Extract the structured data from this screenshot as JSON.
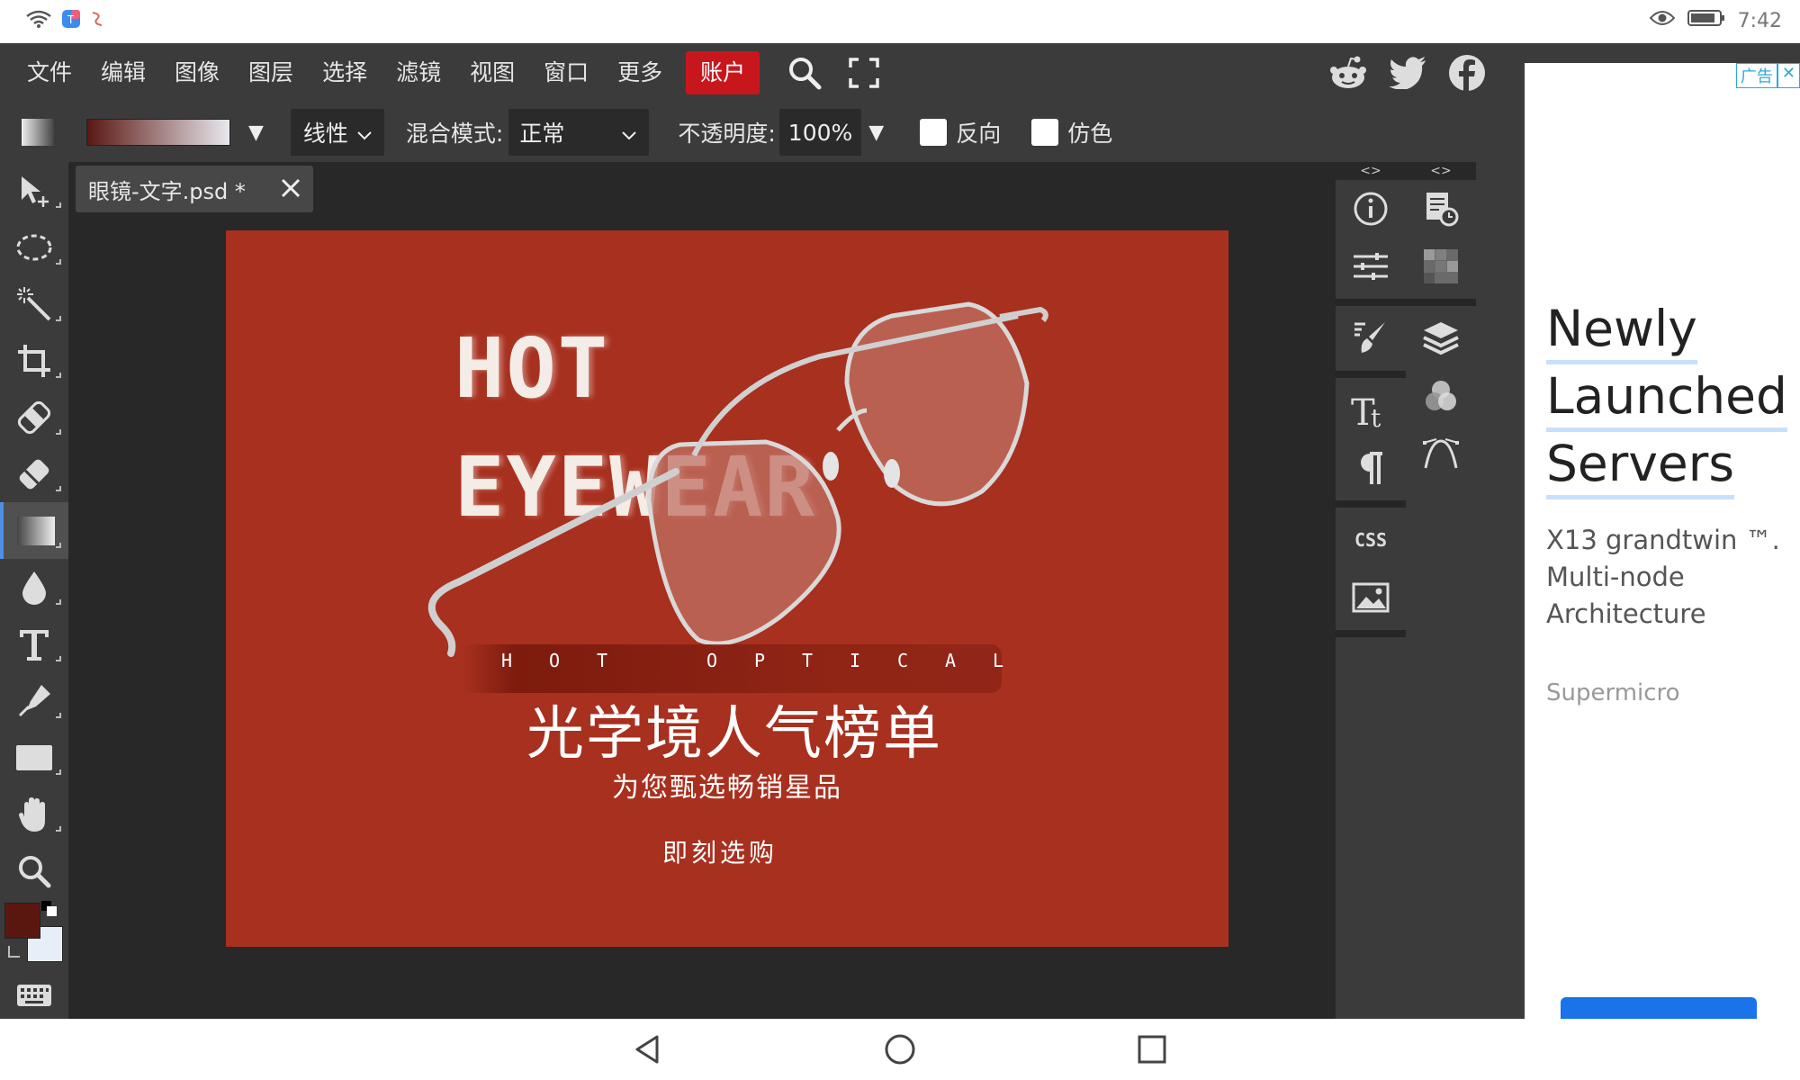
{
  "status_bar": {
    "time": "7:42"
  },
  "menu": {
    "items": [
      "文件",
      "编辑",
      "图像",
      "图层",
      "选择",
      "滤镜",
      "视图",
      "窗口",
      "更多"
    ],
    "account": "账户"
  },
  "options": {
    "gradient_type": "线性",
    "blend_label": "混合模式:",
    "blend_value": "正常",
    "opacity_label": "不透明度:",
    "opacity_value": "100%",
    "reverse_label": "反向",
    "dither_label": "仿色"
  },
  "document": {
    "tab_title": "眼镜-文字.psd *"
  },
  "artwork": {
    "line1": "HOT",
    "line2": "EYEWEAR",
    "tagline_letters": [
      "H",
      "O",
      "T",
      "",
      "O",
      "P",
      "T",
      "I",
      "C",
      "A",
      "L"
    ],
    "headline": "光学境人气榜单",
    "subline": "为您甄选畅销星品",
    "cta": "即刻选购"
  },
  "panels": {
    "collapse_label": "<>",
    "css_label": "CSS"
  },
  "ad": {
    "badge": "广告",
    "title_lines": [
      "Newly",
      "Launched",
      "Servers"
    ],
    "body": "X13 grandtwin ™. Multi-node Architecture",
    "brand": "Supermicro"
  },
  "colors": {
    "canvas_bg": "#a8301f",
    "foreground": "#5a1710",
    "background": "#e8eef8",
    "account_red": "#c8161d",
    "active_tool_accent": "#4f8fe6"
  }
}
